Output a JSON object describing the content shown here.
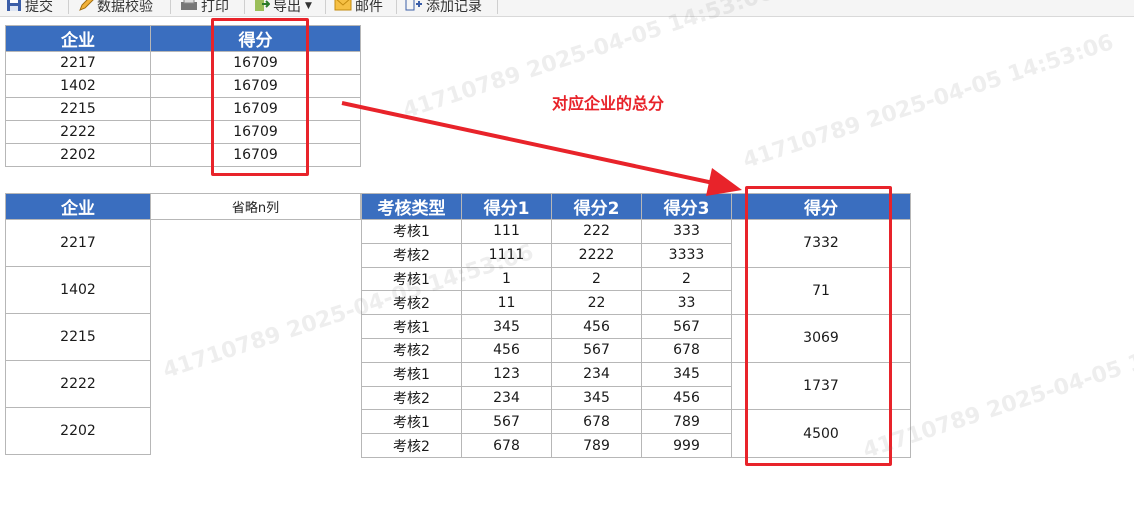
{
  "toolbar": {
    "submit": "提交",
    "validate": "数据校验",
    "print": "打印",
    "export": "导出",
    "mail": "邮件",
    "add_record": "添加记录"
  },
  "top_table": {
    "headers": [
      "企业",
      "得分"
    ],
    "rows": [
      [
        "2217",
        "16709"
      ],
      [
        "1402",
        "16709"
      ],
      [
        "2215",
        "16709"
      ],
      [
        "2222",
        "16709"
      ],
      [
        "2202",
        "16709"
      ]
    ]
  },
  "annotation": "对应企业的总分",
  "bottom_table": {
    "headers": {
      "company": "企业",
      "omitted": "省略n列",
      "type": "考核类型",
      "s1": "得分1",
      "s2": "得分2",
      "s3": "得分3",
      "score": "得分"
    },
    "groups": [
      {
        "company": "2217",
        "score": "7332",
        "rows": [
          [
            "考核1",
            "111",
            "222",
            "333"
          ],
          [
            "考核2",
            "1111",
            "2222",
            "3333"
          ]
        ]
      },
      {
        "company": "1402",
        "score": "71",
        "rows": [
          [
            "考核1",
            "1",
            "2",
            "2"
          ],
          [
            "考核2",
            "11",
            "22",
            "33"
          ]
        ]
      },
      {
        "company": "2215",
        "score": "3069",
        "rows": [
          [
            "考核1",
            "345",
            "456",
            "567"
          ],
          [
            "考核2",
            "456",
            "567",
            "678"
          ]
        ]
      },
      {
        "company": "2222",
        "score": "1737",
        "rows": [
          [
            "考核1",
            "123",
            "234",
            "345"
          ],
          [
            "考核2",
            "234",
            "345",
            "456"
          ]
        ]
      },
      {
        "company": "2202",
        "score": "4500",
        "rows": [
          [
            "考核1",
            "567",
            "678",
            "789"
          ],
          [
            "考核2",
            "678",
            "789",
            "999"
          ]
        ]
      }
    ]
  },
  "watermark": "41710789 2025-04-05 14:53:06",
  "colors": {
    "header_bg": "#3a6ebf",
    "highlight": "#e8232a"
  }
}
